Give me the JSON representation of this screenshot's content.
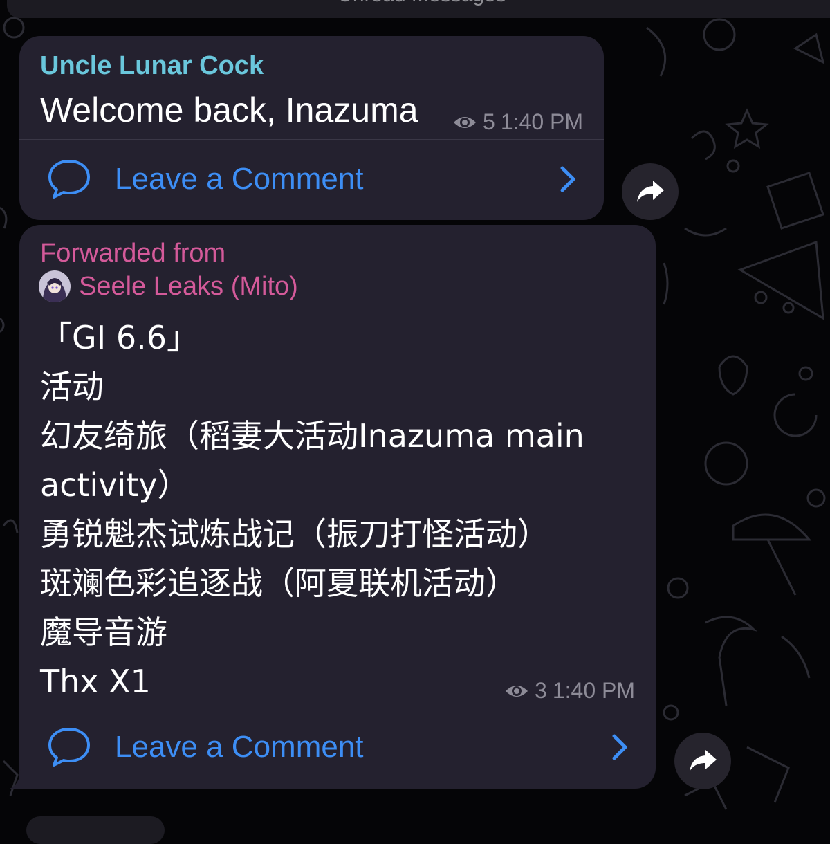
{
  "banner": {
    "text": "Unread Messages"
  },
  "messages": [
    {
      "sender": "Uncle Lunar Cock",
      "text": "Welcome back, Inazuma",
      "views": "5",
      "time": "1:40 PM",
      "comment_label": "Leave a Comment"
    },
    {
      "forwarded_label": "Forwarded from",
      "forwarded_source": "Seele Leaks (Mito)",
      "lines": [
        "「GI 6.6」",
        "活动",
        "幻友绮旅（稻妻大活动Inazuma main",
        "activity）",
        "勇锐魁杰试炼战记（振刀打怪活动）",
        "斑斓色彩追逐战（阿夏联机活动）",
        "魔导音游",
        "Thx X1"
      ],
      "views": "3",
      "time": "1:40 PM",
      "comment_label": "Leave a Comment"
    }
  ],
  "icons": {
    "views": "eye-icon",
    "comment": "speech-bubble-icon",
    "chevron": "chevron-right-icon",
    "share": "share-arrow-icon"
  },
  "colors": {
    "bubble": "#24212f",
    "sender": "#6ac7dc",
    "forwarded": "#d45a9a",
    "link": "#3d8ef5",
    "meta": "#8d8b97"
  }
}
